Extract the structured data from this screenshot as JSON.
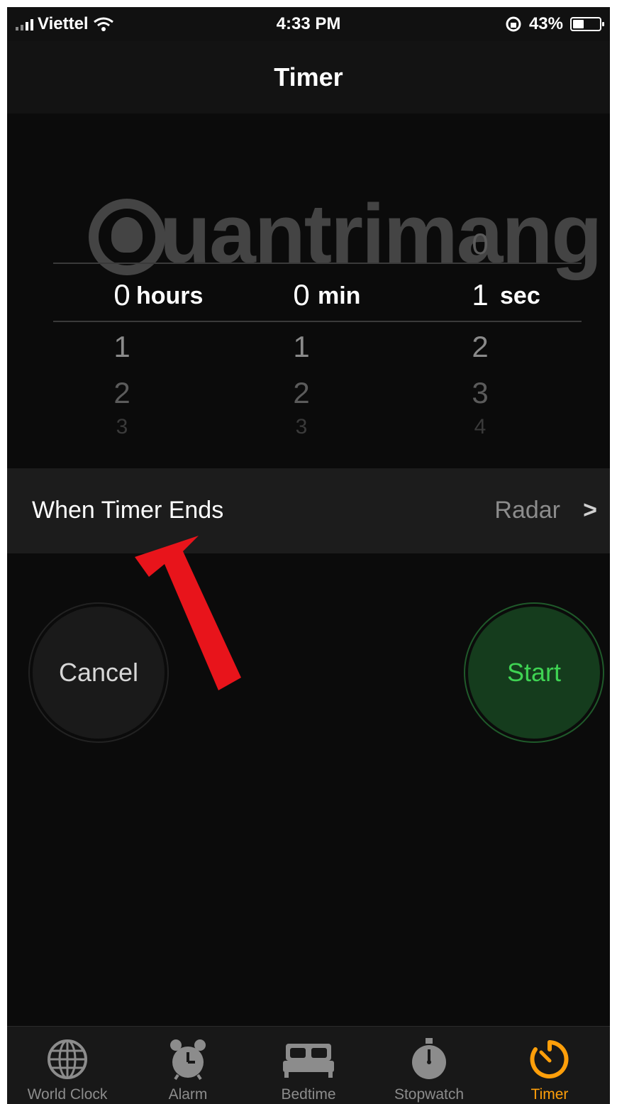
{
  "status": {
    "carrier": "Viettel",
    "time": "4:33 PM",
    "battery": "43%",
    "battery_level": 0.43
  },
  "nav": {
    "title": "Timer"
  },
  "picker": {
    "hours": {
      "above": "",
      "selected": "0",
      "unit": "hours",
      "below1": "1",
      "below2": "2",
      "below3": "3"
    },
    "minutes": {
      "above": "",
      "selected": "0",
      "unit": "min",
      "below1": "1",
      "below2": "2",
      "below3": "3"
    },
    "seconds": {
      "above": "0",
      "selected": "1",
      "unit": "sec",
      "below1": "2",
      "below2": "3",
      "below3": "4"
    }
  },
  "timer_end": {
    "label": "When Timer Ends",
    "value": "Radar"
  },
  "buttons": {
    "cancel": "Cancel",
    "start": "Start"
  },
  "watermark": {
    "text": "uantrimang"
  },
  "tabs": [
    {
      "label": "World Clock",
      "icon": "globe-icon"
    },
    {
      "label": "Alarm",
      "icon": "alarm-clock-icon"
    },
    {
      "label": "Bedtime",
      "icon": "bed-icon"
    },
    {
      "label": "Stopwatch",
      "icon": "stopwatch-icon"
    },
    {
      "label": "Timer",
      "icon": "timer-icon",
      "active": true
    }
  ],
  "colors": {
    "accent": "#ff9f0a",
    "start_text": "#3fd353",
    "arrow": "#e8141b"
  }
}
